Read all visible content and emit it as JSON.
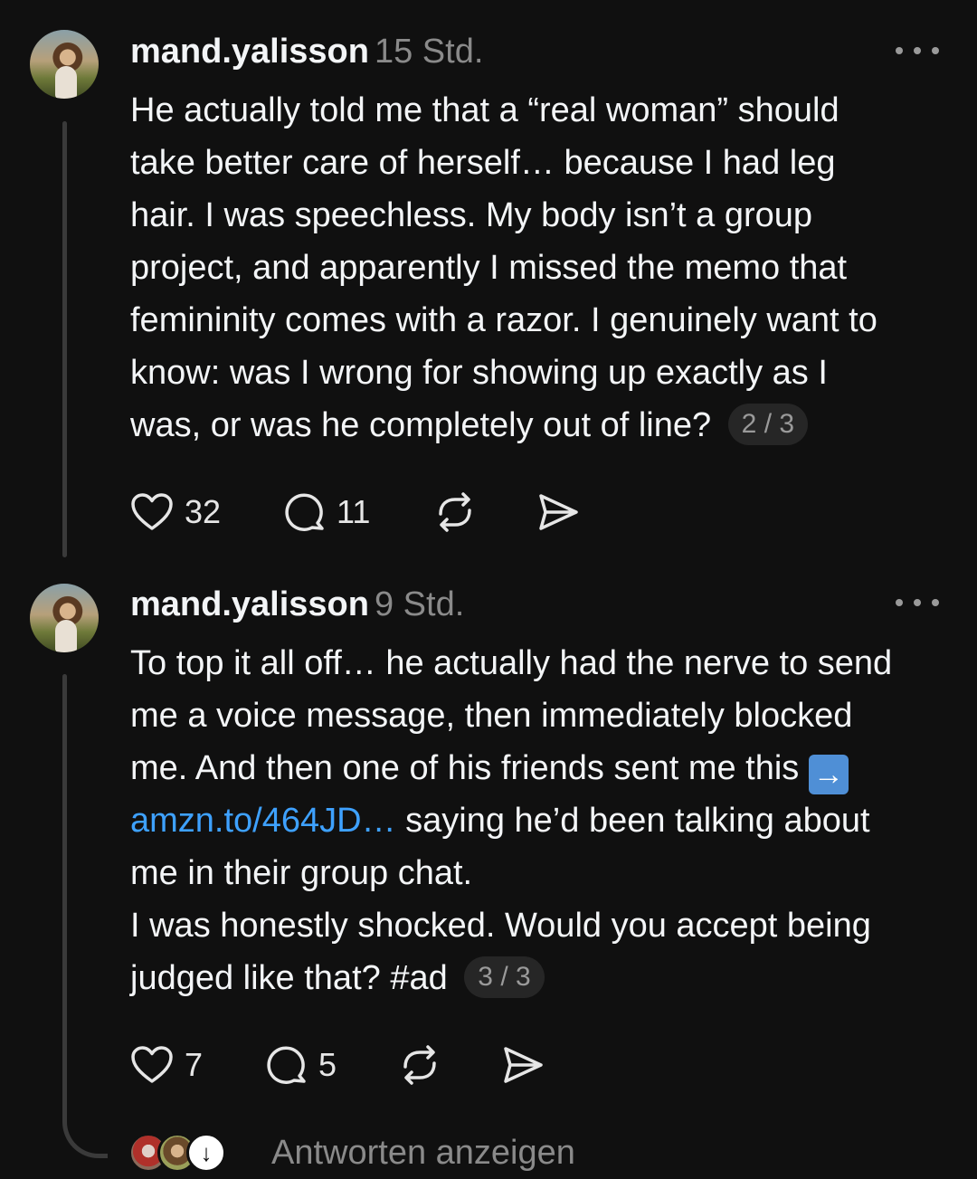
{
  "posts": [
    {
      "username": "mand.yalisson",
      "time": "15 Std.",
      "lines": [
        "He actually told me that a “real woman” should",
        "take better care of herself… because I had leg",
        "hair. I was speechless. My body isn’t a group",
        "project, and apparently I missed the memo that",
        "femininity comes with a razor. I genuinely want to",
        "know: was I wrong for showing up exactly as I",
        "was, or was he completely out of line?"
      ],
      "counter": "2 / 3",
      "likes": "32",
      "comments": "11"
    },
    {
      "username": "mand.yalisson",
      "time": "9 Std.",
      "lines": [
        "To top it all off… he actually had the nerve to send",
        "me a voice message, then immediately blocked",
        "me. And then one of his friends sent me this",
        "saying he’d been talking about",
        "me in their group chat.",
        "I was honestly shocked. Would you accept being",
        "judged like that? #ad"
      ],
      "link": "amzn.to/464JD…",
      "counter": "3 / 3",
      "likes": "7",
      "comments": "5"
    }
  ],
  "show_replies_label": "Antworten anzeigen",
  "icons": {
    "like": "heart-icon",
    "comment": "speech-bubble-icon",
    "repost": "repost-icon",
    "share": "send-icon",
    "more": "more-dots-icon",
    "arrow_emoji": "right-arrow-emoji-icon",
    "expand": "arrow-down-icon"
  },
  "colors": {
    "background": "#101010",
    "text": "#f3f5f7",
    "muted": "#8a8a8a",
    "link": "#3ea1ff"
  }
}
